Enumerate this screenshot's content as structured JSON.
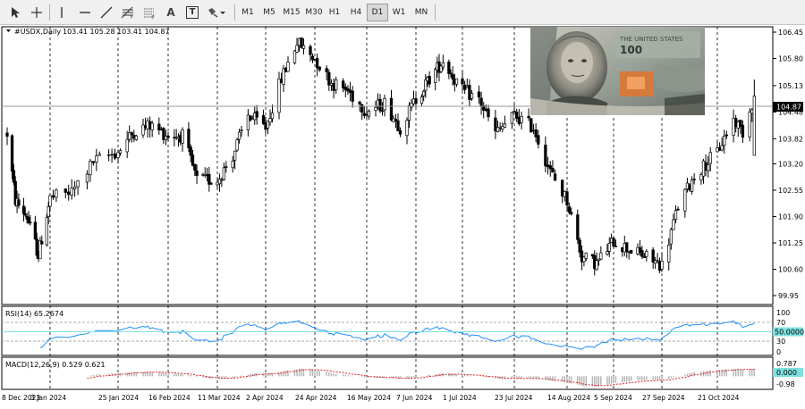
{
  "toolbar": {
    "tools": [
      {
        "name": "cursor-icon"
      },
      {
        "name": "crosshair-icon"
      },
      {
        "name": "vertical-line-icon"
      },
      {
        "name": "horizontal-line-icon"
      },
      {
        "name": "trendline-icon"
      },
      {
        "name": "fibonacci-icon"
      },
      {
        "name": "fibonacci-fan-icon"
      },
      {
        "name": "text-label-icon",
        "glyph": "A"
      },
      {
        "name": "text-box-icon",
        "glyph": "T"
      },
      {
        "name": "shapes-dropdown-icon"
      }
    ],
    "timeframes": [
      "M1",
      "M5",
      "M15",
      "M30",
      "H1",
      "H4",
      "D1",
      "W1",
      "MN"
    ],
    "active_timeframe": "D1"
  },
  "main": {
    "symbol": "#USDX,Daily",
    "ohlc": "103.41 105.28 103.41 104.87",
    "current_price": "104.87",
    "price_ticks": [
      "106.45",
      "105.80",
      "105.13",
      "104.48",
      "103.82",
      "103.20",
      "102.55",
      "101.90",
      "101.25",
      "100.60",
      "99.95"
    ]
  },
  "rsi": {
    "label": "RSI(14) 65.2674",
    "scale": [
      "100",
      "70",
      "30",
      "0"
    ],
    "current_label": "50.0000"
  },
  "macd": {
    "label": "MACD(12,26,9) 0.529 0.621",
    "scale_top": "0.787",
    "current_label": "0.000",
    "scale_bottom": "-0.98"
  },
  "date_axis": [
    "8 Dec 2023",
    "3 Jan 2024",
    "25 Jan 2024",
    "16 Feb 2024",
    "11 Mar 2024",
    "2 Apr 2024",
    "24 Apr 2024",
    "16 May 2024",
    "7 Jun 2024",
    "1 Jul 2024",
    "23 Jul 2024",
    "14 Aug 2024",
    "5 Sep 2024",
    "27 Sep 2024",
    "21 Oct 2024"
  ],
  "colors": {
    "candle": "#000000",
    "rsi_line": "#1e90ff",
    "macd_hist": "#b4b4b4",
    "macd_signal": "#e02020",
    "level_box": "#7fe0e0"
  },
  "chart_data": {
    "type": "candlestick",
    "instrument": "#USDX",
    "timeframe": "Daily",
    "ylim": [
      99.95,
      106.45
    ],
    "close_path_x": [
      "8 Dec 2023",
      "13 Dec 2023",
      "20 Dec 2023",
      "27 Dec 2023",
      "3 Jan 2024",
      "10 Jan 2024",
      "17 Jan 2024",
      "25 Jan 2024",
      "1 Feb 2024",
      "8 Feb 2024",
      "16 Feb 2024",
      "23 Feb 2024",
      "1 Mar 2024",
      "11 Mar 2024",
      "18 Mar 2024",
      "25 Mar 2024",
      "2 Apr 2024",
      "9 Apr 2024",
      "16 Apr 2024",
      "24 Apr 2024",
      "1 May 2024",
      "8 May 2024",
      "16 May 2024",
      "24 May 2024",
      "31 May 2024",
      "7 Jun 2024",
      "14 Jun 2024",
      "21 Jun 2024",
      "1 Jul 2024",
      "8 Jul 2024",
      "15 Jul 2024",
      "23 Jul 2024",
      "31 Jul 2024",
      "7 Aug 2024",
      "14 Aug 2024",
      "21 Aug 2024",
      "28 Aug 2024",
      "5 Sep 2024",
      "12 Sep 2024",
      "20 Sep 2024",
      "27 Sep 2024",
      "4 Oct 2024",
      "11 Oct 2024",
      "21 Oct 2024",
      "28 Oct 2024",
      "1 Nov 2024",
      "6 Nov 2024"
    ],
    "close_path_y": [
      103.95,
      102.3,
      101.9,
      100.95,
      102.35,
      102.5,
      103.25,
      103.5,
      104.0,
      104.15,
      103.9,
      103.9,
      102.8,
      102.8,
      103.4,
      104.4,
      104.1,
      105.3,
      106.2,
      105.8,
      105.2,
      105.0,
      104.5,
      104.7,
      104.1,
      104.8,
      105.3,
      105.75,
      105.0,
      104.8,
      103.95,
      104.4,
      104.1,
      103.0,
      102.3,
      100.9,
      100.75,
      101.3,
      101.1,
      100.9,
      100.7,
      102.15,
      102.9,
      103.5,
      104.3,
      104.0,
      104.87
    ],
    "rsi": {
      "ylim": [
        0,
        100
      ],
      "levels": [
        70,
        30
      ],
      "last": 65.2674
    },
    "macd": {
      "params": "12,26,9",
      "macd": 0.529,
      "signal": 0.621
    }
  }
}
